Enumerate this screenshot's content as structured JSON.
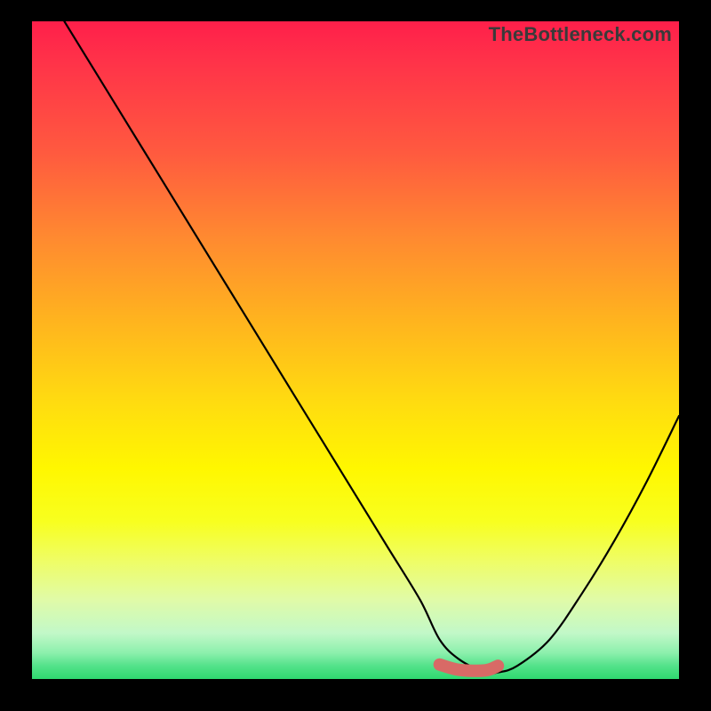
{
  "watermark": "TheBottleneck.com",
  "chart_data": {
    "type": "line",
    "title": "",
    "xlabel": "",
    "ylabel": "",
    "xlim": [
      0,
      100
    ],
    "ylim": [
      0,
      100
    ],
    "grid": false,
    "legend": false,
    "series": [
      {
        "name": "bottleneck-curve",
        "x": [
          5,
          10,
          15,
          20,
          25,
          30,
          35,
          40,
          45,
          50,
          55,
          60,
          63,
          66,
          70,
          72,
          75,
          80,
          85,
          90,
          95,
          100
        ],
        "y": [
          100,
          92,
          84,
          76,
          68,
          60,
          52,
          44,
          36,
          28,
          20,
          12,
          6,
          3,
          1,
          1,
          2,
          6,
          13,
          21,
          30,
          40
        ]
      }
    ],
    "highlight_segment": {
      "name": "flat-optimum",
      "x": [
        63,
        66,
        70,
        72
      ],
      "y": [
        2.2,
        1.4,
        1.3,
        2.0
      ],
      "color": "#d86a66",
      "stroke_width": 14
    },
    "gradient_stops": [
      {
        "pos": 0,
        "color": "#ff1f4a"
      },
      {
        "pos": 20,
        "color": "#ff5a3f"
      },
      {
        "pos": 45,
        "color": "#ffb21f"
      },
      {
        "pos": 68,
        "color": "#fff700"
      },
      {
        "pos": 93,
        "color": "#c2f8c8"
      },
      {
        "pos": 100,
        "color": "#2fd86f"
      }
    ]
  }
}
